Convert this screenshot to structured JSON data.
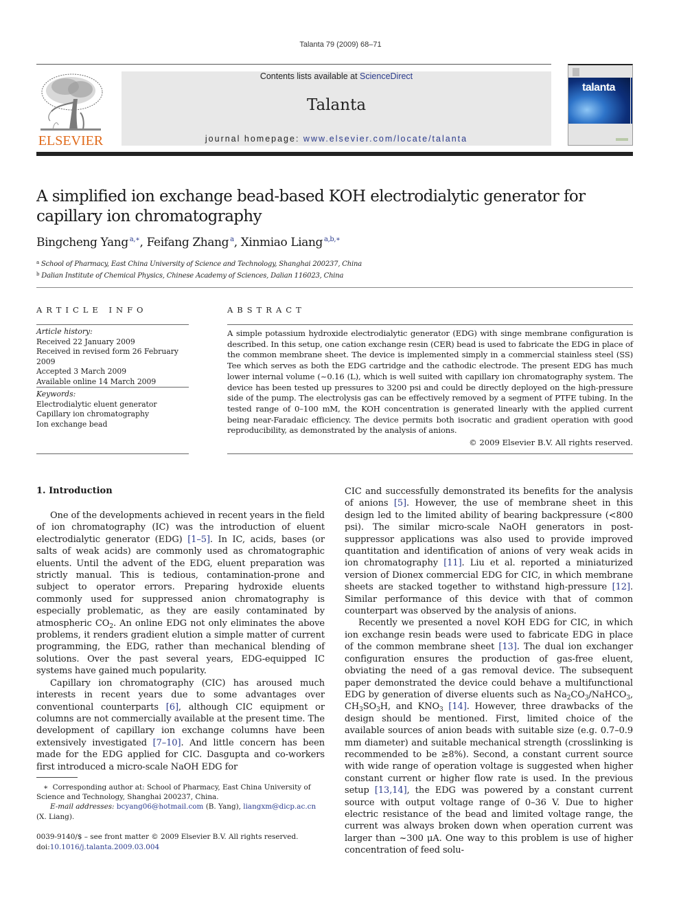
{
  "running_head": "Talanta 79 (2009) 68–71",
  "header": {
    "publisher_logo_text": "ELSEVIER",
    "contents_prefix": "Contents lists available at ",
    "contents_link": "ScienceDirect",
    "journal_title": "Talanta",
    "homepage_prefix": "journal homepage: ",
    "homepage_link": "www.elsevier.com/locate/talanta",
    "cover_title": "talanta",
    "colors": {
      "elsevier_orange": "#e06a1a",
      "link_blue": "#2a3a8c",
      "banner_gray": "#e8e8e8",
      "cover_blue": "#0d2f7a"
    }
  },
  "article": {
    "title": "A simplified ion exchange bead-based KOH electrodialytic generator for capillary ion chromatography",
    "authors": [
      {
        "name": "Bingcheng Yang",
        "sup": "a,∗",
        "sep": ", "
      },
      {
        "name": "Feifang Zhang",
        "sup": "a",
        "sep": ", "
      },
      {
        "name": "Xinmiao Liang",
        "sup": "a,b,∗",
        "sep": ""
      }
    ],
    "affiliations": [
      {
        "mark": "a",
        "text": "School of Pharmacy, East China University of Science and Technology, Shanghai 200237, China"
      },
      {
        "mark": "b",
        "text": "Dalian Institute of Chemical Physics, Chinese Academy of Sciences, Dalian 116023, China"
      }
    ]
  },
  "article_info": {
    "heading": "ARTICLE INFO",
    "history_label": "Article history:",
    "history": [
      "Received 22 January 2009",
      "Received in revised form 26 February 2009",
      "Accepted 3 March 2009",
      "Available online 14 March 2009"
    ],
    "keywords_label": "Keywords:",
    "keywords": [
      "Electrodialytic eluent generator",
      "Capillary ion chromatography",
      "Ion exchange bead"
    ]
  },
  "abstract": {
    "heading": "ABSTRACT",
    "text": "A simple potassium hydroxide electrodialytic generator (EDG) with singe membrane configuration is described. In this setup, one cation exchange resin (CER) bead is used to fabricate the EDG in place of the common membrane sheet. The device is implemented simply in a commercial stainless steel (SS) Tee which serves as both the EDG cartridge and the cathodic electrode. The present EDG has much lower internal volume (~0.16 (L), which is well suited with capillary ion chromatography system. The device has been tested up pressures to 3200 psi and could be directly deployed on the high-pressure side of the pump. The electrolysis gas can be effectively removed by a segment of PTFE tubing. In the tested range of 0–100 mM, the KOH concentration is generated linearly with the applied current being near-Faradaic efficiency. The device permits both isocratic and gradient operation with good reproducibility, as demonstrated by the analysis of anions.",
    "copyright": "© 2009 Elsevier B.V. All rights reserved."
  },
  "body": {
    "section_heading": "1.  Introduction",
    "left": {
      "p1_a": "One of the developments achieved in recent years in the field of ion chromatography (IC) was the introduction of eluent electrodialytic generator (EDG) ",
      "p1_ref1": "[1–5]",
      "p1_b": ". In IC, acids, bases (or salts of weak acids) are commonly used as chromatographic eluents. Until the advent of the EDG, eluent preparation was strictly manual. This is tedious, contamination-prone and subject to operator errors. Preparing hydroxide eluents commonly used for suppressed anion chromatography is especially problematic, as they are easily contaminated by atmospheric CO",
      "p1_sub": "2",
      "p1_c": ". An online EDG not only eliminates the above problems, it renders gradient elution a simple matter of current programming, the EDG, rather than mechanical blending of solutions. Over the past several years, EDG-equipped IC systems have gained much popularity.",
      "p2_a": "Capillary ion chromatography (CIC) has aroused much interests in recent years due to some advantages over conventional counterparts ",
      "p2_ref1": "[6]",
      "p2_b": ", although CIC equipment or columns are not commercially available at the present time. The development of capillary ion exchange columns have been extensively investigated ",
      "p2_ref2": "[7–10]",
      "p2_c": ". And little concern has been made for the EDG applied for CIC. Dasgupta and co-workers first introduced a micro-scale NaOH EDG for"
    },
    "right": {
      "p1_a": "CIC and successfully demonstrated its benefits for the analysis of anions ",
      "p1_ref1": "[5]",
      "p1_b": ". However, the use of membrane sheet in this design led to the limited ability of bearing backpressure (<800 psi). The similar micro-scale NaOH generators in post-suppressor applications was also used to provide improved quantitation and identification of anions of very weak acids in ion chromatography ",
      "p1_ref2": "[11]",
      "p1_c": ". Liu et al. reported a miniaturized version of Dionex commercial EDG for CIC, in which membrane sheets are stacked together to withstand high-pressure ",
      "p1_ref3": "[12]",
      "p1_d": ". Similar performance of this device with that of common counterpart was observed by the analysis of anions.",
      "p2_a": "Recently we presented a novel KOH EDG for CIC, in which ion exchange resin beads were used to fabricate EDG in place of the common membrane sheet ",
      "p2_ref1": "[13]",
      "p2_b": ". The dual ion exchanger configuration ensures the production of gas-free eluent, obviating the need of a gas removal device. The subsequent paper demonstrated the device could behave a multifunctional EDG by generation of diverse eluents such as Na",
      "p2_sub1": "2",
      "p2_c1": "CO",
      "p2_sub2": "3",
      "p2_c2": "/NaHCO",
      "p2_sub3": "3",
      "p2_c3": ", CH",
      "p2_sub4": "3",
      "p2_c4": "SO",
      "p2_sub5": "3",
      "p2_c5": "H, and KNO",
      "p2_sub6": "3",
      "p2_c6": " ",
      "p2_ref2": "[14]",
      "p2_d": ". However, three drawbacks of the design should be mentioned. First, limited choice of the available sources of anion beads with suitable size (e.g. 0.7–0.9 mm diameter) and suitable mechanical strength (crosslinking is recommended to be ≥8%). Second, a constant current source with wide range of operation voltage is suggested when higher constant current or higher flow rate is used. In the previous setup ",
      "p2_ref3": "[13,14]",
      "p2_e": ", the EDG was powered by a constant current source with output voltage range of 0–36 V. Due to higher electric resistance of the bead and limited voltage range, the current was always broken down when operation current was larger than ~300 μA. One way to this problem is use of higher concentration of feed solu-"
    }
  },
  "footnote": {
    "star": "∗",
    "corresponding": "Corresponding author at: School of Pharmacy, East China University of Science and Technology, Shanghai 200237, China.",
    "email_label": "E-mail addresses: ",
    "email1": "bcyang06@hotmail.com",
    "email1_name": " (B. Yang), ",
    "email2": "liangxm@dicp.ac.cn",
    "email2_name": " (X. Liang)."
  },
  "front_matter": {
    "issn_line": "0039-9140/$ – see front matter © 2009 Elsevier B.V. All rights reserved.",
    "doi_prefix": "doi:",
    "doi": "10.1016/j.talanta.2009.03.004"
  }
}
